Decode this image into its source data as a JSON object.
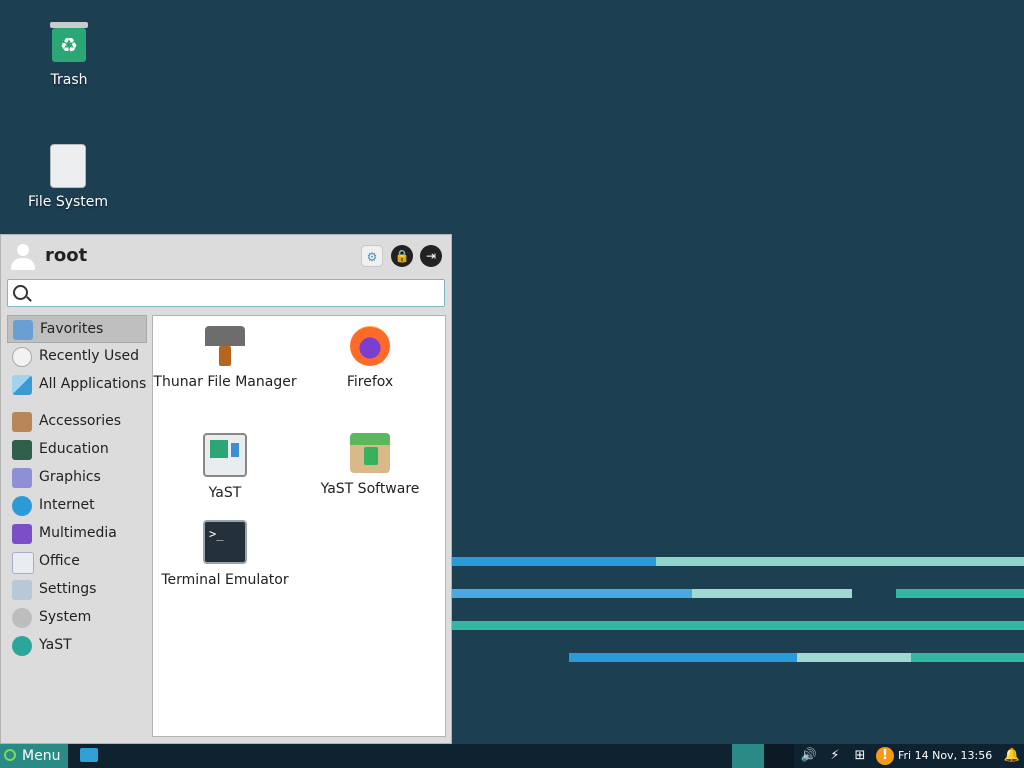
{
  "desktop": {
    "icons": [
      {
        "label": "Trash",
        "icon": "trash-icon"
      },
      {
        "label": "File System",
        "icon": "drive-icon"
      }
    ]
  },
  "menu": {
    "username": "root",
    "search": {
      "value": "",
      "placeholder": ""
    },
    "header_buttons": [
      "settings-icon",
      "lock-icon",
      "logout-icon"
    ],
    "categories_top": [
      {
        "label": "Favorites",
        "icon": "favorites-icon",
        "active": true
      },
      {
        "label": "Recently Used",
        "icon": "clock-icon"
      },
      {
        "label": "All Applications",
        "icon": "apps-grid-icon"
      }
    ],
    "categories": [
      {
        "label": "Accessories",
        "icon": "briefcase-icon"
      },
      {
        "label": "Education",
        "icon": "chalkboard-icon"
      },
      {
        "label": "Graphics",
        "icon": "graphics-icon"
      },
      {
        "label": "Internet",
        "icon": "globe-icon"
      },
      {
        "label": "Multimedia",
        "icon": "multimedia-icon"
      },
      {
        "label": "Office",
        "icon": "office-icon"
      },
      {
        "label": "Settings",
        "icon": "settings-icon"
      },
      {
        "label": "System",
        "icon": "gear-icon"
      },
      {
        "label": "YaST",
        "icon": "yast-icon"
      }
    ],
    "apps": [
      {
        "label": "Thunar File Manager",
        "icon": "file-manager-icon"
      },
      {
        "label": "Firefox",
        "icon": "firefox-icon"
      },
      {
        "label": "YaST",
        "icon": "yast-icon"
      },
      {
        "label": "YaST Software",
        "icon": "package-icon"
      },
      {
        "label": "Terminal Emulator",
        "icon": "terminal-icon"
      }
    ]
  },
  "taskbar": {
    "menu_label": "Menu",
    "clock": "Fri 14 Nov, 13:56",
    "tray_icons": [
      "volume-icon",
      "power-icon",
      "network-icon",
      "updates-icon",
      "bell-icon"
    ]
  },
  "colors": {
    "desktop_bg": "#1d3f52",
    "stripe_blue": "#2b9ad8",
    "stripe_teal": "#35b6a0",
    "stripe_light": "#8fd6c8",
    "accent": "#2a8a85"
  }
}
